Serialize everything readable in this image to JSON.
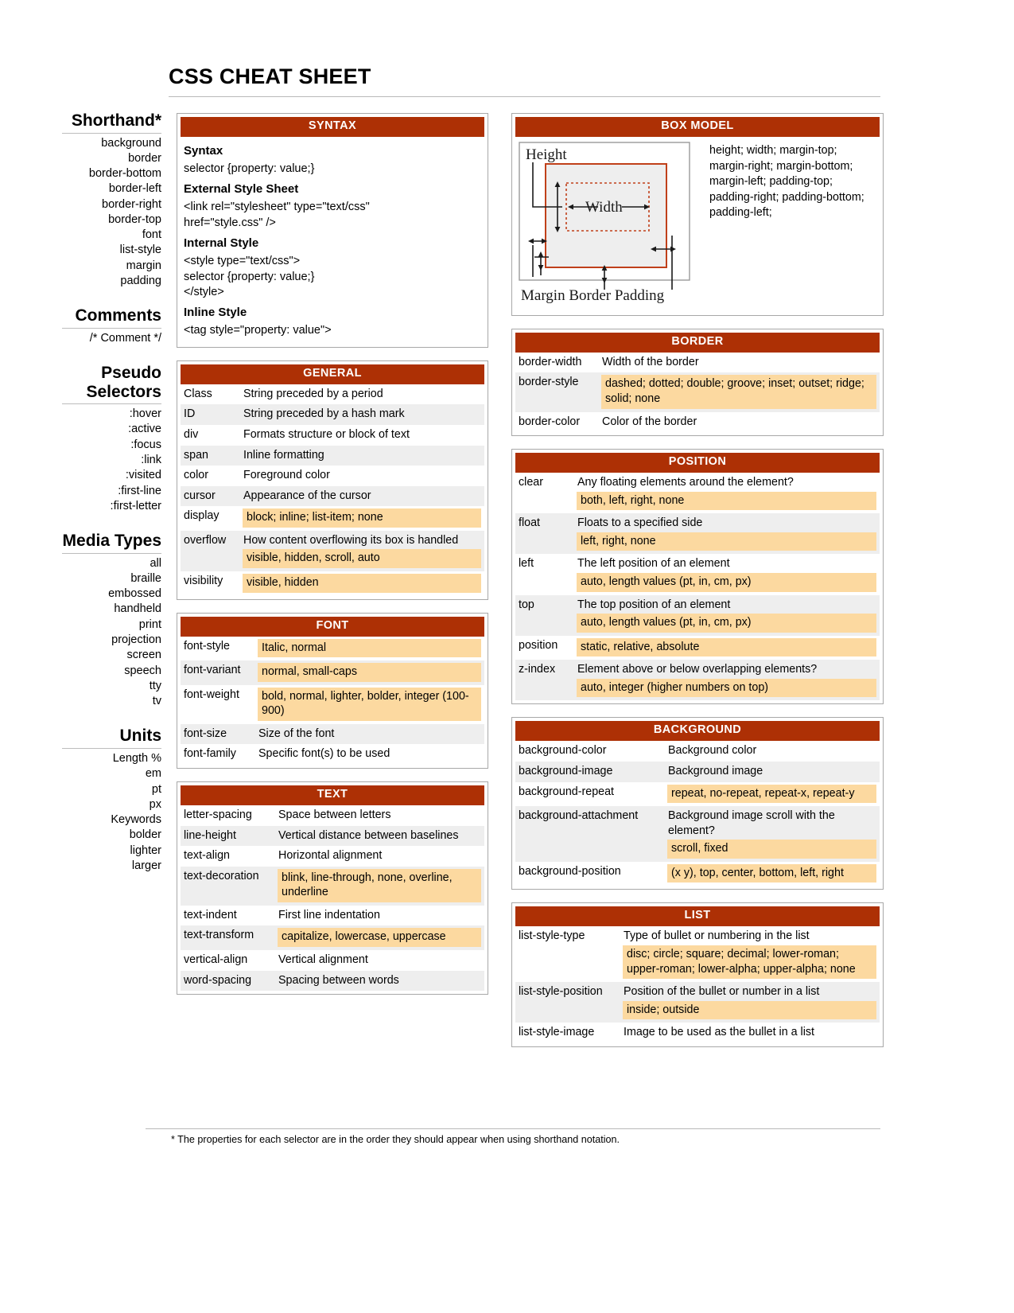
{
  "title": "CSS CHEAT SHEET",
  "footnote": "* The properties for each selector are in the order they should appear when using shorthand notation.",
  "colors": {
    "header_bar": "#ad3005",
    "value_highlight": "#fcd9a0",
    "row_alt": "#eeeeee",
    "panel_border": "#a8a8a8",
    "diagram_accent": "#c0401a"
  },
  "sidebar": {
    "groups": [
      {
        "heading": "Shorthand*",
        "items": [
          "background",
          "border",
          "border-bottom",
          "border-left",
          "border-right",
          "border-top",
          "font",
          "list-style",
          "margin",
          "padding"
        ]
      },
      {
        "heading": "Comments",
        "items": [
          "/* Comment */"
        ]
      },
      {
        "heading": "Pseudo Selectors",
        "items": [
          ":hover",
          ":active",
          ":focus",
          ":link",
          ":visited",
          ":first-line",
          ":first-letter"
        ]
      },
      {
        "heading": "Media Types",
        "items": [
          "all",
          "braille",
          "embossed",
          "handheld",
          "print",
          "projection",
          "screen",
          "speech",
          "tty",
          "tv"
        ]
      },
      {
        "heading": "Units",
        "items": [
          "Length %",
          "em",
          "pt",
          "px",
          "Keywords",
          "bolder",
          "lighter",
          "larger"
        ]
      }
    ]
  },
  "syntax": {
    "title": "SYNTAX",
    "blocks": [
      {
        "heading": "Syntax",
        "code": "selector {property: value;}"
      },
      {
        "heading": "External Style Sheet",
        "code": "<link rel=\"stylesheet\" type=\"text/css\"\nhref=\"style.css\" />"
      },
      {
        "heading": "Internal Style",
        "code": "<style type=\"text/css\">\nselector {property: value;}\n</style>"
      },
      {
        "heading": "Inline Style",
        "code": "<tag style=\"property: value\">"
      }
    ]
  },
  "general": {
    "title": "GENERAL",
    "rows": [
      {
        "key": "Class",
        "desc": "String preceded by a period",
        "values": ""
      },
      {
        "key": "ID",
        "desc": "String preceded by a hash mark",
        "values": ""
      },
      {
        "key": "div",
        "desc": "Formats structure or block of text",
        "values": ""
      },
      {
        "key": "span",
        "desc": "Inline formatting",
        "values": ""
      },
      {
        "key": "color",
        "desc": "Foreground color",
        "values": ""
      },
      {
        "key": "cursor",
        "desc": "Appearance of the cursor",
        "values": ""
      },
      {
        "key": "display",
        "desc": "",
        "values": "block; inline; list-item; none"
      },
      {
        "key": "overflow",
        "desc": "How content overflowing its box is handled",
        "values": "visible, hidden, scroll, auto"
      },
      {
        "key": "visibility",
        "desc": "",
        "values": "visible, hidden"
      }
    ]
  },
  "font": {
    "title": "FONT",
    "rows": [
      {
        "key": "font-style",
        "desc": "",
        "values": "Italic, normal"
      },
      {
        "key": "font-variant",
        "desc": "",
        "values": "normal, small-caps"
      },
      {
        "key": "font-weight",
        "desc": "",
        "values": "bold, normal, lighter, bolder, integer (100-900)"
      },
      {
        "key": "font-size",
        "desc": "Size of the font",
        "values": ""
      },
      {
        "key": "font-family",
        "desc": "Specific font(s) to be used",
        "values": ""
      }
    ]
  },
  "text": {
    "title": "TEXT",
    "rows": [
      {
        "key": "letter-spacing",
        "desc": "Space between letters",
        "values": ""
      },
      {
        "key": "line-height",
        "desc": "Vertical distance between baselines",
        "values": ""
      },
      {
        "key": "text-align",
        "desc": "Horizontal alignment",
        "values": ""
      },
      {
        "key": "text-decoration",
        "desc": "",
        "values": "blink, line-through, none, overline, underline"
      },
      {
        "key": "text-indent",
        "desc": "First line indentation",
        "values": ""
      },
      {
        "key": "text-transform",
        "desc": "",
        "values": "capitalize, lowercase, uppercase"
      },
      {
        "key": "vertical-align",
        "desc": "Vertical alignment",
        "values": ""
      },
      {
        "key": "word-spacing",
        "desc": "Spacing between words",
        "values": ""
      }
    ]
  },
  "box_model": {
    "title": "BOX MODEL",
    "properties": "height; width; margin-top; margin-right; margin-bottom; margin-left; padding-top; padding-right; padding-bottom; padding-left;",
    "diagram_labels": {
      "height": "Height",
      "width": "Width",
      "caption": "Margin Border Padding"
    }
  },
  "border": {
    "title": "BORDER",
    "rows": [
      {
        "key": "border-width",
        "desc": "Width of the border",
        "values": ""
      },
      {
        "key": "border-style",
        "desc": "",
        "values": "dashed; dotted; double; groove; inset; outset; ridge; solid; none"
      },
      {
        "key": "border-color",
        "desc": "Color of the border",
        "values": ""
      }
    ]
  },
  "position": {
    "title": "POSITION",
    "rows": [
      {
        "key": "clear",
        "desc": "Any floating elements around the element?",
        "values": "both, left, right, none"
      },
      {
        "key": "float",
        "desc": "Floats to a specified side",
        "values": "left, right, none"
      },
      {
        "key": "left",
        "desc": "The left position of an element",
        "values": "auto, length values (pt, in, cm, px)"
      },
      {
        "key": "top",
        "desc": "The top position of an element",
        "values": "auto, length values (pt, in, cm, px)"
      },
      {
        "key": "position",
        "desc": "",
        "values": "static, relative, absolute"
      },
      {
        "key": "z-index",
        "desc": "Element above or below overlapping elements?",
        "values": "auto, integer (higher numbers on top)"
      }
    ]
  },
  "background": {
    "title": "BACKGROUND",
    "rows": [
      {
        "key": "background-color",
        "desc": "Background color",
        "values": ""
      },
      {
        "key": "background-image",
        "desc": "Background image",
        "values": ""
      },
      {
        "key": "background-repeat",
        "desc": "",
        "values": "repeat, no-repeat, repeat-x, repeat-y"
      },
      {
        "key": "background-attachment",
        "desc": "Background image scroll with the element?",
        "values": "scroll, fixed"
      },
      {
        "key": "background-position",
        "desc": "",
        "values": "(x y), top, center, bottom, left, right"
      }
    ]
  },
  "list": {
    "title": "LIST",
    "rows": [
      {
        "key": "list-style-type",
        "desc": "Type of bullet or numbering in the list",
        "values": "disc; circle; square; decimal; lower-roman; upper-roman; lower-alpha; upper-alpha; none"
      },
      {
        "key": "list-style-position",
        "desc": "Position of the bullet or number in a list",
        "values": "inside; outside"
      },
      {
        "key": "list-style-image",
        "desc": "Image to be used as the bullet in a list",
        "values": ""
      }
    ]
  }
}
